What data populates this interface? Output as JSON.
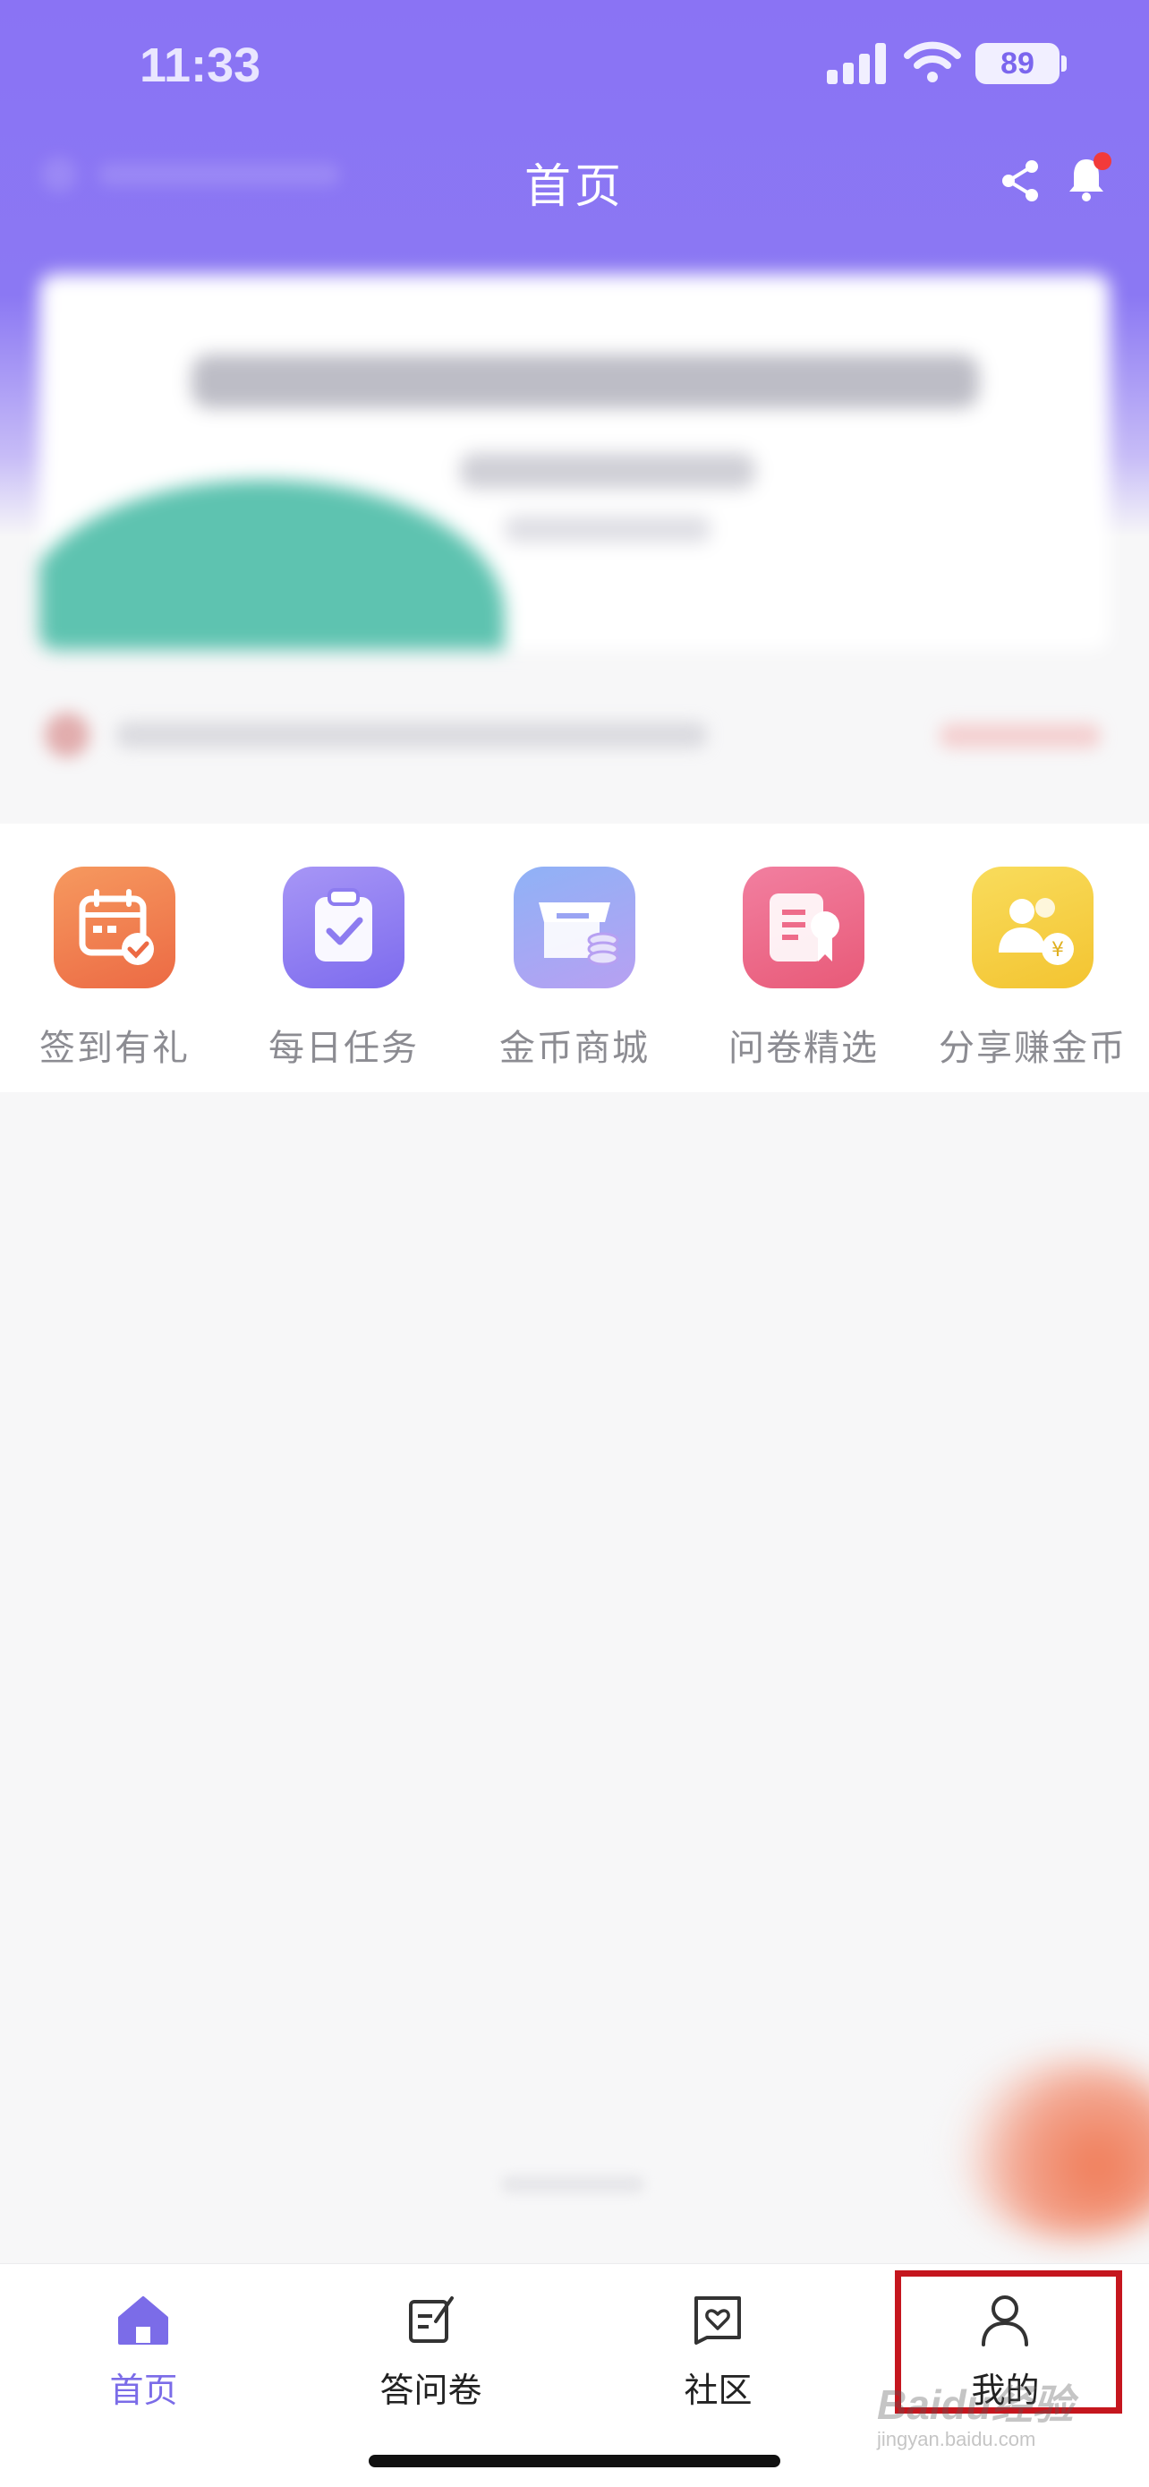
{
  "status_bar": {
    "time": "11:33",
    "battery": "89"
  },
  "nav": {
    "title": "首页"
  },
  "quick_actions": [
    {
      "label": "签到有礼",
      "icon": "calendar-check-icon",
      "color": "#f07a4a"
    },
    {
      "label": "每日任务",
      "icon": "clipboard-check-icon",
      "color": "#8d7cf0"
    },
    {
      "label": "金币商城",
      "icon": "store-coins-icon",
      "color": "#9aa4f3"
    },
    {
      "label": "问卷精选",
      "icon": "document-badge-icon",
      "color": "#ee6c8a"
    },
    {
      "label": "分享赚金币",
      "icon": "people-coin-icon",
      "color": "#f5cf43"
    }
  ],
  "tabs": [
    {
      "label": "首页",
      "icon": "home-icon",
      "active": true
    },
    {
      "label": "答问卷",
      "icon": "edit-note-icon",
      "active": false
    },
    {
      "label": "社区",
      "icon": "heart-chat-icon",
      "active": false
    },
    {
      "label": "我的",
      "icon": "person-icon",
      "active": false
    }
  ],
  "watermark": {
    "brand": "Baidu经验",
    "site": "jingyan.baidu.com"
  },
  "colors": {
    "accent": "#7b6ce8",
    "header": "#8a73f4",
    "highlight": "#c5161e"
  }
}
